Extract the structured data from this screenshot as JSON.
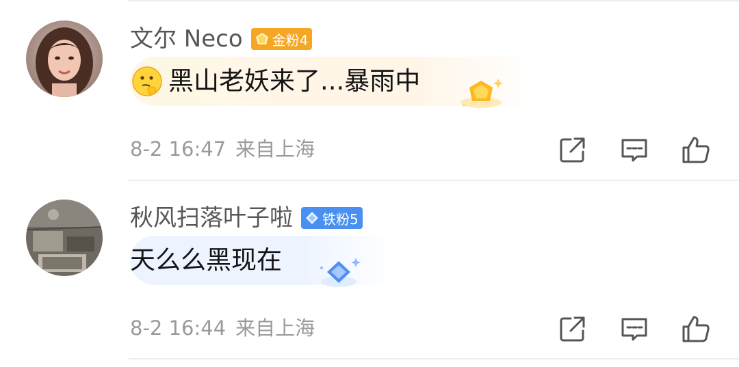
{
  "comments": [
    {
      "username": "文尔 Neco",
      "badge": {
        "label": "金粉4",
        "color": "#f5a623"
      },
      "emoji": "thinking-face-emoji",
      "text": "黑山老妖来了...暴雨中",
      "time": "8-2 16:47",
      "location": "来自上海"
    },
    {
      "username": "秋风扫落叶子啦",
      "badge": {
        "label": "铁粉5",
        "color": "#4a90f0"
      },
      "text": "天么么黑现在",
      "time": "8-2 16:44",
      "location": "来自上海"
    }
  ],
  "icons": {
    "share": "share-icon",
    "comment": "comment-icon",
    "like": "like-icon"
  }
}
